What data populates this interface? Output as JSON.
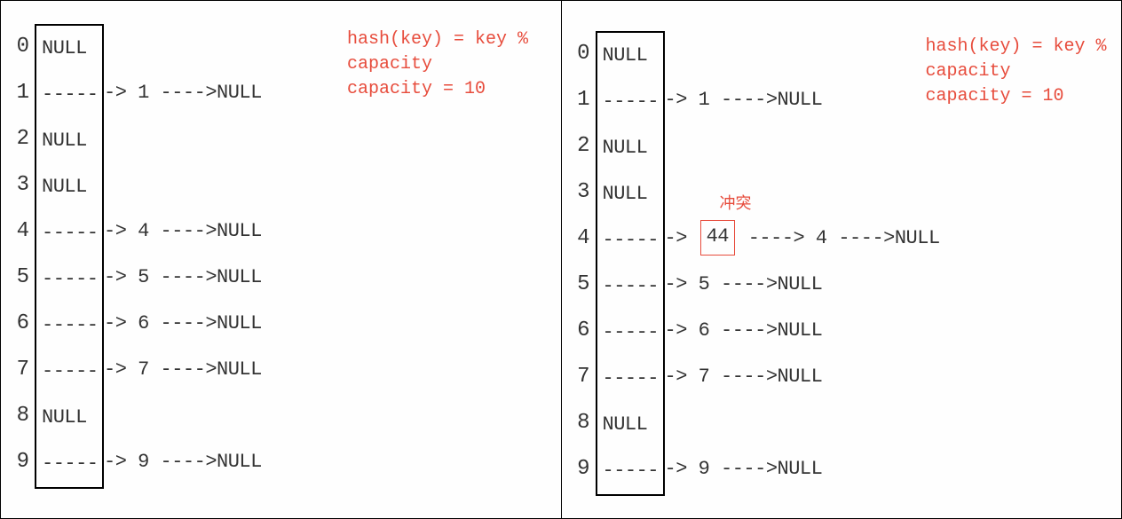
{
  "formula": {
    "line1": "hash(key) = key %",
    "line2": "capacity",
    "line3": "capacity = 10"
  },
  "collision_label": "冲突",
  "null_label": "NULL",
  "arrow_short": "---->",
  "arrow_long": "------>",
  "left_table": {
    "indices": [
      "0",
      "1",
      "2",
      "3",
      "4",
      "5",
      "6",
      "7",
      "8",
      "9"
    ],
    "buckets": [
      "NULL",
      "-----",
      "NULL",
      "NULL",
      "-----",
      "-----",
      "-----",
      "-----",
      "NULL",
      "-----"
    ],
    "chains": [
      "",
      "-> 1 ---->NULL",
      "",
      "",
      "-> 4 ---->NULL",
      "-> 5 ---->NULL",
      "-> 6 ---->NULL",
      "-> 7 ---->NULL",
      "",
      "-> 9 ---->NULL"
    ]
  },
  "right_table": {
    "indices": [
      "0",
      "1",
      "2",
      "3",
      "4",
      "5",
      "6",
      "7",
      "8",
      "9"
    ],
    "buckets": [
      "NULL",
      "-----",
      "NULL",
      "NULL",
      "-----",
      "-----",
      "-----",
      "-----",
      "NULL",
      "-----"
    ],
    "chain_prefix_4": "->",
    "chain_collision_val": "44",
    "chain_suffix_4": "----> 4 ---->NULL",
    "chains": [
      "",
      "-> 1 ---->NULL",
      "",
      "",
      "",
      "-> 5 ---->NULL",
      "-> 6 ---->NULL",
      "-> 7 ---->NULL",
      "",
      "-> 9 ---->NULL"
    ]
  }
}
